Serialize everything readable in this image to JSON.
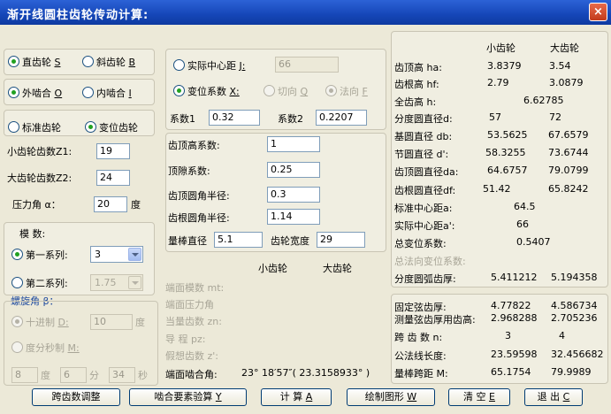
{
  "window": {
    "title": "渐开线圆柱齿轮传动计算:",
    "close": "×"
  },
  "left": {
    "gear_type": {
      "straight": "直齿轮",
      "straight_key": "S",
      "helical": "斜齿轮",
      "helical_key": "B"
    },
    "mesh": {
      "external": "外啮合",
      "external_key": "O",
      "internal": "内啮合",
      "internal_key": "I"
    },
    "gear_mode": {
      "standard": "标准齿轮",
      "modified": "变位齿轮"
    },
    "z1_label": "小齿轮齿数Z1:",
    "z1_value": "19",
    "z2_label": "大齿轮齿数Z2:",
    "z2_value": "24",
    "alpha_label": "压力角 α：",
    "alpha_value": "20",
    "alpha_unit": "度",
    "module_title": "模  数:",
    "series1_label": "第一系列:",
    "series1_value": "3",
    "series2_label": "第二系列:",
    "series2_value": "1.75",
    "helix_title": "螺旋角  β：",
    "decimal_label": "十进制",
    "decimal_key": "D:",
    "decimal_value": "10",
    "decimal_unit": "度",
    "dms_label": "度分秒制",
    "dms_key": "M:",
    "deg_value": "8",
    "deg_unit": "度",
    "min_value": "6",
    "min_unit": "分",
    "sec_value": "34",
    "sec_unit": "秒"
  },
  "middle": {
    "actual_center": "实际中心距",
    "actual_center_key": "J:",
    "actual_center_value": "66",
    "shift_coef": "变位系数",
    "shift_coef_key": "X:",
    "tangential": "切向",
    "tangential_key": "Q",
    "normal": "法向",
    "normal_key": "F",
    "coef1_label": "系数1",
    "coef1_value": "0.32",
    "coef2_label": "系数2",
    "coef2_value": "0.2207",
    "addendum_coef_label": "齿顶高系数:",
    "addendum_coef_value": "1",
    "clearance_coef_label": "顶隙系数:",
    "clearance_coef_value": "0.25",
    "tip_fillet_label": "齿顶圆角半径:",
    "tip_fillet_value": "0.3",
    "root_fillet_label": "齿根圆角半径:",
    "root_fillet_value": "1.14",
    "rod_dia_label": "量棒直径",
    "rod_dia_value": "5.1",
    "face_width_label": "齿轮宽度",
    "face_width_value": "29",
    "col_small": "小齿轮",
    "col_big": "大齿轮",
    "transverse_module": "端面模数 mt:",
    "transverse_pressure": "端面压力角",
    "equiv_teeth": "当量齿数 zn:",
    "lead": "导    程  pz:",
    "virtual_teeth": "假想齿数 z':",
    "transverse_contact_label": "端面啮合角:",
    "transverse_contact_value": "23° 18′57″( 23.3158933° )"
  },
  "right": {
    "col_small": "小齿轮",
    "col_big": "大齿轮",
    "rows1": [
      {
        "label": "齿顶高 ha:",
        "small": "3.8379",
        "big": "3.54"
      },
      {
        "label": "齿根高 hf:",
        "small": "2.79",
        "big": "3.0879"
      }
    ],
    "whole_depth_label": "全齿高 h:",
    "whole_depth_value": "6.62785",
    "rows2": [
      {
        "label": "分度圆直径d:",
        "small": "57",
        "big": "72"
      },
      {
        "label": "基圆直径 db:",
        "small": "53.5625",
        "big": "67.6579"
      },
      {
        "label": "节圆直径 d':",
        "small": "58.3255",
        "big": "73.6744"
      },
      {
        "label": "齿顶圆直径da:",
        "small": "64.6757",
        "big": "79.0799"
      },
      {
        "label": "齿根圆直径df:",
        "small": "51.42",
        "big": "65.8242"
      }
    ],
    "std_center_label": "标准中心距a:",
    "std_center_value": "64.5",
    "act_center_label": "实际中心距a':",
    "act_center_value": "66",
    "total_shift_label": "总变位系数:",
    "total_shift_value": "0.5407",
    "total_normal_shift_label": "总法向变位系数:",
    "pitch_thickness_label": "分度圆弧齿厚:",
    "pitch_thickness_small": "5.411212",
    "pitch_thickness_big": "5.194358",
    "fixed_chord_label": "固定弦齿厚:",
    "fixed_chord_small": "4.77822",
    "fixed_chord_big": "4.586734",
    "fixed_chord_height_label": "测量弦齿厚用齿高:",
    "fixed_chord_height_small": "2.968288",
    "fixed_chord_height_big": "2.705236",
    "span_teeth_label": "跨 齿 数 n:",
    "span_teeth_small": "3",
    "span_teeth_big": "4",
    "base_tangent_label": "公法线长度:",
    "base_tangent_small": "23.59598",
    "base_tangent_big": "32.456682",
    "over_pins_label": "量棒跨距 M:",
    "over_pins_small": "65.1754",
    "over_pins_big": "79.9989"
  },
  "buttons": {
    "span_adjust": "跨齿数调整",
    "mesh_check": "啮合要素验算",
    "mesh_check_key": "Y",
    "calc": "计  算",
    "calc_key": "A",
    "draw": "绘制图形",
    "draw_key": "W",
    "clear": "清  空",
    "clear_key": "E",
    "exit": "退  出",
    "exit_key": "C"
  }
}
